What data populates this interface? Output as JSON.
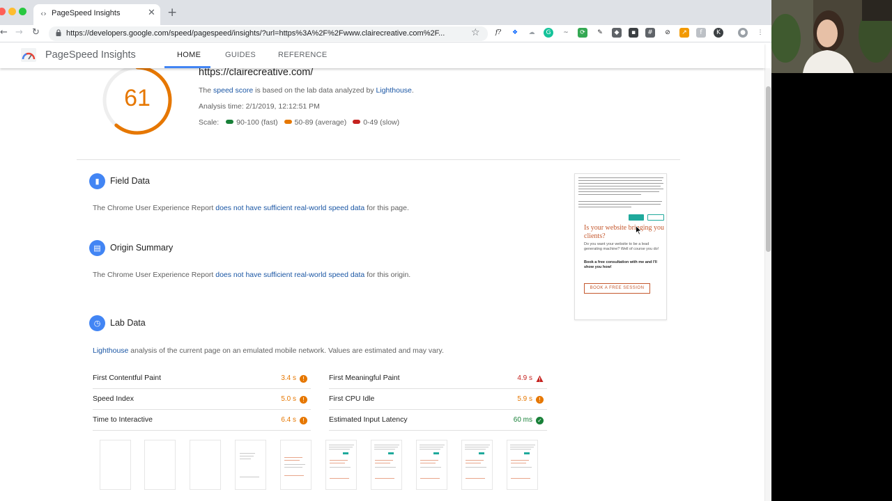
{
  "browser": {
    "tab_title": "PageSpeed Insights",
    "url": "https://developers.google.com/speed/pagespeed/insights/?url=https%3A%2F%2Fwww.clairecreative.com%2F..."
  },
  "header": {
    "app_name": "PageSpeed Insights",
    "nav": [
      "HOME",
      "GUIDES",
      "REFERENCE"
    ]
  },
  "summary": {
    "score": "61",
    "score_fraction": 0.61,
    "score_color": "#e67700",
    "site_url": "https://clairecreative.com/",
    "desc_prefix": "The ",
    "desc_link1": "speed score",
    "desc_middle": " is based on the lab data analyzed by ",
    "desc_link2": "Lighthouse",
    "desc_suffix": ".",
    "analysis_time": "Analysis time: 2/1/2019, 12:12:51 PM",
    "scale_label": "Scale:",
    "scale": [
      {
        "label": "90-100 (fast)",
        "color": "#188038"
      },
      {
        "label": "50-89 (average)",
        "color": "#e67700"
      },
      {
        "label": "0-49 (slow)",
        "color": "#c5221f"
      }
    ]
  },
  "field_data": {
    "title": "Field Data",
    "text_prefix": "The Chrome User Experience Report ",
    "text_link": "does not have sufficient real-world speed data",
    "text_suffix": " for this page."
  },
  "origin_summary": {
    "title": "Origin Summary",
    "text_prefix": "The Chrome User Experience Report ",
    "text_link": "does not have sufficient real-world speed data",
    "text_suffix": " for this origin."
  },
  "lab_data": {
    "title": "Lab Data",
    "text_link": "Lighthouse",
    "text_suffix": " analysis of the current page on an emulated mobile network. Values are estimated and may vary.",
    "metrics_left": [
      {
        "label": "First Contentful Paint",
        "value": "3.4 s",
        "status": "average"
      },
      {
        "label": "Speed Index",
        "value": "5.0 s",
        "status": "average"
      },
      {
        "label": "Time to Interactive",
        "value": "6.4 s",
        "status": "average"
      }
    ],
    "metrics_right": [
      {
        "label": "First Meaningful Paint",
        "value": "4.9 s",
        "status": "slow"
      },
      {
        "label": "First CPU Idle",
        "value": "5.9 s",
        "status": "average"
      },
      {
        "label": "Estimated Input Latency",
        "value": "60 ms",
        "status": "fast"
      }
    ]
  },
  "preview": {
    "heading": "Is your website bringing you clients?",
    "body": "Do you want your website to be a lead generating machine? Well of course you do!",
    "bold": "Book a free consultation with me and I'll show you how!",
    "cta": "BOOK A FREE SESSION"
  },
  "colors": {
    "average": "#e67700",
    "slow": "#c5221f",
    "fast": "#188038",
    "link": "#1a56a4",
    "accent": "#4285f4"
  }
}
